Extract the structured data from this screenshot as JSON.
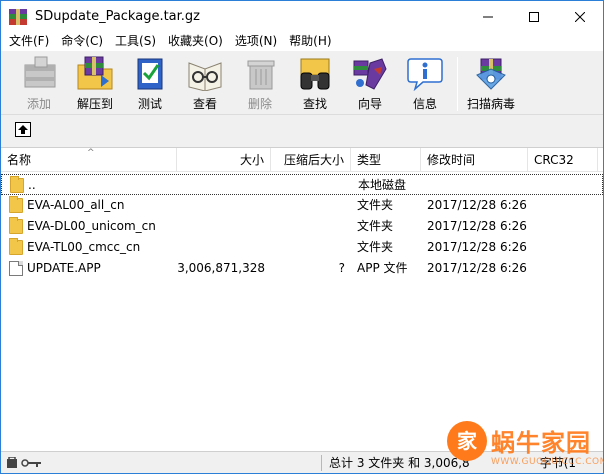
{
  "window": {
    "title": "SDupdate_Package.tar.gz",
    "controls": [
      "minimize",
      "maximize",
      "close"
    ]
  },
  "menu": [
    "文件(F)",
    "命令(C)",
    "工具(S)",
    "收藏夹(O)",
    "选项(N)",
    "帮助(H)"
  ],
  "toolbar": {
    "add": "添加",
    "extract": "解压到",
    "test": "测试",
    "view": "查看",
    "delete": "删除",
    "find": "查找",
    "wizard": "向导",
    "info": "信息",
    "scan": "扫描病毒"
  },
  "columns": {
    "name": "名称",
    "size": "大小",
    "packed": "压缩后大小",
    "type": "类型",
    "modified": "修改时间",
    "crc": "CRC32"
  },
  "files": [
    {
      "name": "..",
      "size": "",
      "packed": "",
      "type": "本地磁盘",
      "modified": "",
      "crc": "",
      "icon": "folder-icon"
    },
    {
      "name": "EVA-AL00_all_cn",
      "size": "",
      "packed": "",
      "type": "文件夹",
      "modified": "2017/12/28 6:26",
      "crc": "",
      "icon": "folder-icon"
    },
    {
      "name": "EVA-DL00_unicom_cn",
      "size": "",
      "packed": "",
      "type": "文件夹",
      "modified": "2017/12/28 6:26",
      "crc": "",
      "icon": "folder-icon"
    },
    {
      "name": "EVA-TL00_cmcc_cn",
      "size": "",
      "packed": "",
      "type": "文件夹",
      "modified": "2017/12/28 6:26",
      "crc": "",
      "icon": "folder-icon"
    },
    {
      "name": "UPDATE.APP",
      "size": "3,006,871,328",
      "packed": "?",
      "type": "APP 文件",
      "modified": "2017/12/28 6:26",
      "crc": "",
      "icon": "file-icon"
    }
  ],
  "status": {
    "summary": "总计 3 文件夹 和 3,006,8",
    "summary_tail": "字节(1"
  },
  "watermark": {
    "text": "蜗牛家园",
    "logo_char": "家",
    "sub": "WWW.GUOQUICCC.COM"
  }
}
